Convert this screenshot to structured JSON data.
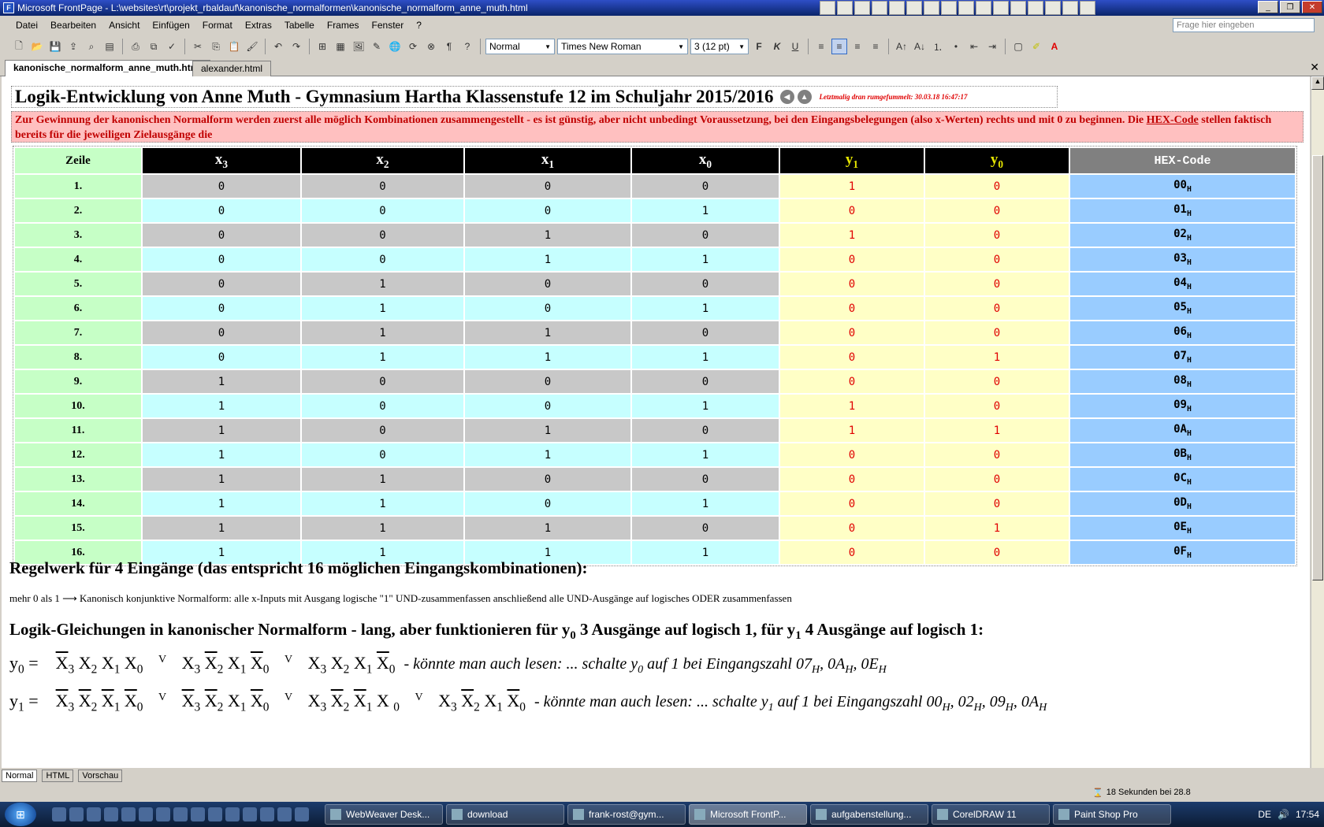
{
  "window": {
    "title": "Microsoft FrontPage - L:\\websites\\rt\\projekt_rbaldauf\\kanonische_normalformen\\kanonische_normalform_anne_muth.html"
  },
  "menu": [
    "Datei",
    "Bearbeiten",
    "Ansicht",
    "Einfügen",
    "Format",
    "Extras",
    "Tabelle",
    "Frames",
    "Fenster",
    "?"
  ],
  "help_placeholder": "Frage hier eingeben",
  "toolbar": {
    "style": "Normal",
    "font": "Times New Roman",
    "size": "3  (12 pt)",
    "bold": "F",
    "italic": "K",
    "underline": "U"
  },
  "tabs": [
    "kanonische_normalform_anne_muth.html",
    "alexander.html"
  ],
  "page": {
    "title": "Logik-Entwicklung von Anne Muth - Gymnasium Hartha Klassenstufe 12 im Schuljahr 2015/2016",
    "last_modified": "Letztmalig dran rumgefummelt: 30.03.18 16:47:17",
    "intro": "Zur Gewinnung der kanonischen Normalform werden zuerst alle möglich Kombinationen zusammengestellt - es ist günstig, aber nicht unbedingt Voraussetzung, bei den Eingangsbelegungen (also x-Werten) rechts und mit 0 zu beginnen. Die ",
    "intro_link": "HEX-Code",
    "intro_tail": " stellen faktisch bereits für die jeweiligen Zielausgänge die",
    "table": {
      "header_zeile": "Zeile",
      "header_x": "x",
      "header_y": "y",
      "header_hex": "HEX-Code",
      "sub3": "3",
      "sub2": "2",
      "sub1": "1",
      "sub0": "0",
      "hex_sub": "H",
      "rows": [
        {
          "z": "1.",
          "x3": "0",
          "x2": "0",
          "x1": "0",
          "x0": "0",
          "y1": "1",
          "y0": "0",
          "hex": "00"
        },
        {
          "z": "2.",
          "x3": "0",
          "x2": "0",
          "x1": "0",
          "x0": "1",
          "y1": "0",
          "y0": "0",
          "hex": "01"
        },
        {
          "z": "3.",
          "x3": "0",
          "x2": "0",
          "x1": "1",
          "x0": "0",
          "y1": "1",
          "y0": "0",
          "hex": "02"
        },
        {
          "z": "4.",
          "x3": "0",
          "x2": "0",
          "x1": "1",
          "x0": "1",
          "y1": "0",
          "y0": "0",
          "hex": "03"
        },
        {
          "z": "5.",
          "x3": "0",
          "x2": "1",
          "x1": "0",
          "x0": "0",
          "y1": "0",
          "y0": "0",
          "hex": "04"
        },
        {
          "z": "6.",
          "x3": "0",
          "x2": "1",
          "x1": "0",
          "x0": "1",
          "y1": "0",
          "y0": "0",
          "hex": "05"
        },
        {
          "z": "7.",
          "x3": "0",
          "x2": "1",
          "x1": "1",
          "x0": "0",
          "y1": "0",
          "y0": "0",
          "hex": "06"
        },
        {
          "z": "8.",
          "x3": "0",
          "x2": "1",
          "x1": "1",
          "x0": "1",
          "y1": "0",
          "y0": "1",
          "hex": "07"
        },
        {
          "z": "9.",
          "x3": "1",
          "x2": "0",
          "x1": "0",
          "x0": "0",
          "y1": "0",
          "y0": "0",
          "hex": "08"
        },
        {
          "z": "10.",
          "x3": "1",
          "x2": "0",
          "x1": "0",
          "x0": "1",
          "y1": "1",
          "y0": "0",
          "hex": "09"
        },
        {
          "z": "11.",
          "x3": "1",
          "x2": "0",
          "x1": "1",
          "x0": "0",
          "y1": "1",
          "y0": "1",
          "hex": "0A"
        },
        {
          "z": "12.",
          "x3": "1",
          "x2": "0",
          "x1": "1",
          "x0": "1",
          "y1": "0",
          "y0": "0",
          "hex": "0B"
        },
        {
          "z": "13.",
          "x3": "1",
          "x2": "1",
          "x1": "0",
          "x0": "0",
          "y1": "0",
          "y0": "0",
          "hex": "0C"
        },
        {
          "z": "14.",
          "x3": "1",
          "x2": "1",
          "x1": "0",
          "x0": "1",
          "y1": "0",
          "y0": "0",
          "hex": "0D"
        },
        {
          "z": "15.",
          "x3": "1",
          "x2": "1",
          "x1": "1",
          "x0": "0",
          "y1": "0",
          "y0": "1",
          "hex": "0E"
        },
        {
          "z": "16.",
          "x3": "1",
          "x2": "1",
          "x1": "1",
          "x0": "1",
          "y1": "0",
          "y0": "0",
          "hex": "0F"
        }
      ]
    },
    "h2a": "Regelwerk für 4 Eingänge (das entspricht 16 möglichen Eingangskombinationen):",
    "rule": "mehr 0 als 1 ⟶ Kanonisch konjunktive Normalform: alle x-Inputs mit Ausgang logische \"1\" UND-zusammenfassen anschließend alle UND-Ausgänge auf logisches ODER zusammenfassen",
    "h2b_1": "Logik-Gleichungen in kanonischer Normalform - lang, aber funktionieren für y",
    "h2b_2": " 3 Ausgänge auf logisch 1, für y",
    "h2b_3": " 4 Ausgänge auf logisch 1:",
    "eq_y0_comment": "- könnte man auch lesen: ... schalte y",
    "eq_y0_comment2": " auf 1 bei Eingangszahl 07",
    "eq_y0_rest": ", 0A",
    "eq_y0_rest2": ", 0E",
    "eq_y1_comment": "- könnte man auch lesen: ... schalte y",
    "eq_y1_comment2": " auf 1 bei Eingangszahl 00",
    "eq_y1_rest1": ", 02",
    "eq_y1_rest2": ", 09",
    "eq_y1_rest3": ", 0A"
  },
  "view_tabs": [
    "Normal",
    "HTML",
    "Vorschau"
  ],
  "status": {
    "time_msg": "18 Sekunden bei 28.8"
  },
  "taskbar": {
    "tasks": [
      "WebWeaver Desk...",
      "download",
      "frank-rost@gym...",
      "Microsoft FrontP...",
      "aufgabenstellung...",
      "CorelDRAW 11",
      "Paint Shop Pro"
    ],
    "lang": "DE",
    "clock": "17:54"
  },
  "colors": {
    "zeile_bg": "#c6ffc6",
    "x_gray": "#c8c8c8",
    "x_cyan": "#c6ffff",
    "y_bg": "#ffffc6",
    "hex_bg": "#99ccff",
    "intro_bg": "#ffc0c0"
  }
}
